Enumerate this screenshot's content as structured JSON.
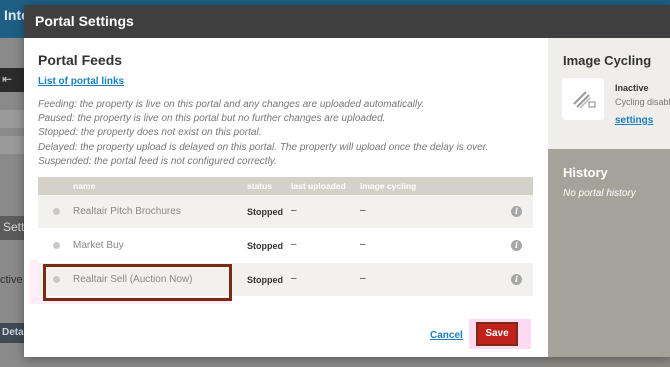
{
  "background": {
    "title_fragment": "Inte",
    "sett_fragment": "Sett",
    "active_fragment": "ctive",
    "deta_fragment": "Deta"
  },
  "modal": {
    "title": "Portal Settings"
  },
  "portal_feeds": {
    "title": "Portal Feeds",
    "list_link": "List of portal links",
    "descriptions": [
      "Feeding: the property is live on this portal and any changes are uploaded automatically.",
      "Paused: the property is live on this portal but no further changes are uploaded.",
      "Stopped: the property does not exist on this portal.",
      "Delayed: the property upload is delayed on this portal. The property will upload once the delay is over.",
      "Suspended: the portal feed is not configured correctly."
    ],
    "columns": {
      "name": "name",
      "status": "status",
      "last_uploaded": "last uploaded",
      "image_cycling": "image cycling"
    },
    "rows": [
      {
        "name": "Realtair Pitch Brochures",
        "status": "Stopped",
        "last_uploaded": "–",
        "image_cycling": "–",
        "info": "i"
      },
      {
        "name": "Market Buy",
        "status": "Stopped",
        "last_uploaded": "–",
        "image_cycling": "–",
        "info": "i"
      },
      {
        "name": "Realtair Sell (Auction Now)",
        "status": "Stopped",
        "last_uploaded": "–",
        "image_cycling": "–",
        "info": "i"
      }
    ],
    "cancel_label": "Cancel",
    "save_label": "Save"
  },
  "image_cycling": {
    "title": "Image Cycling",
    "state": "Inactive",
    "description": "Cycling disabled",
    "settings_link": "settings"
  },
  "history": {
    "title": "History",
    "empty_text": "No portal history"
  },
  "colors": {
    "header_bg": "#3f3f3f",
    "link": "#1a7fc0",
    "save_bg": "#c0221b",
    "history_bg": "#a5a399"
  }
}
